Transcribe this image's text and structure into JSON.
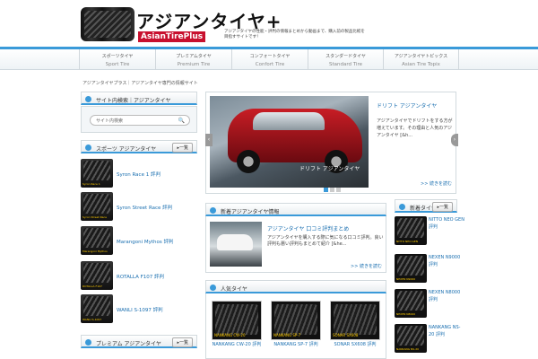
{
  "header": {
    "title": "アジアンタイヤ+",
    "brand": "AsianTirePlus",
    "tagline": "アジアンタイヤの性能・評判の情報まとめから動画まで、購入前の製品比較を目指すサイトです！"
  },
  "nav": [
    {
      "jp": "スポーツタイヤ",
      "en": "Sport Tire"
    },
    {
      "jp": "プレミアムタイヤ",
      "en": "Premium Tire"
    },
    {
      "jp": "コンフォートタイヤ",
      "en": "Confort Tire"
    },
    {
      "jp": "スタンダードタイヤ",
      "en": "Standard Tire"
    },
    {
      "jp": "アジアンタイヤトピックス",
      "en": "Asian Tire Topix"
    }
  ],
  "breadcrumb": "アジアンタイヤプラス｜アジアンタイヤ専門の情報サイト",
  "search": {
    "title": "サイト内検索｜アジアンタイヤ",
    "placeholder": "サイト内検索"
  },
  "sport_list": {
    "title": "スポーツ アジアンタイヤ",
    "more": "一覧",
    "items": [
      {
        "name": "Syron Race 1 評判",
        "tag": "Syron Race 1"
      },
      {
        "name": "Syron Street Race 評判",
        "tag": "Syron Street Race"
      },
      {
        "name": "Marangoni Mythos 評判",
        "tag": "Marangoni Mythos"
      },
      {
        "name": "ROTALLA F107 評判",
        "tag": "ROTALLA F107"
      },
      {
        "name": "WANLI S-1097 評判",
        "tag": "WANLI S-1097"
      }
    ]
  },
  "premium_list": {
    "title": "プレミアム アジアンタイヤ",
    "more": "一覧"
  },
  "slider": {
    "caption": "ドリフト アジアンタイヤ",
    "title": "ドリフト アジアンタイヤ",
    "excerpt": "アジアンタイヤでドリフトをする方が増えています。その理由と人気のアジアンタイヤ [&h...",
    "more": ">> 続きを読む"
  },
  "news": {
    "title": "新着アジアンタイヤ情報",
    "item_title": "アジアンタイヤ 口コミ評判まとめ",
    "excerpt": "アジアンタイヤを購入する際に気になる口コミ評判。良い評判も悪い評判もまとめて紹介 [&he...",
    "more": ">> 続きを読む"
  },
  "products": {
    "title": "人気タイヤ",
    "items": [
      {
        "name": "NANKANG CW-20 評判",
        "tag": "NANKANG CW-20"
      },
      {
        "name": "NANKANG SP-7 評判",
        "tag": "NANKANG SP-7"
      },
      {
        "name": "SONAR SX608 評判",
        "tag": "SONAR SX608"
      }
    ]
  },
  "right_list": {
    "title": "新着タイヤ",
    "more": "一覧",
    "items": [
      {
        "name": "NITTO NEO GEN 評判",
        "tag": "NITTO NEO GEN"
      },
      {
        "name": "NEXEN N9000 評判",
        "tag": "NEXEN N9000"
      },
      {
        "name": "NEXEN N8000 評判",
        "tag": "NEXEN N8000"
      },
      {
        "name": "NANKANG NS-20 評判",
        "tag": "NANKANG NS-20"
      }
    ]
  },
  "colors": {
    "accent": "#3a9ad9",
    "link": "#1a6fb0"
  }
}
